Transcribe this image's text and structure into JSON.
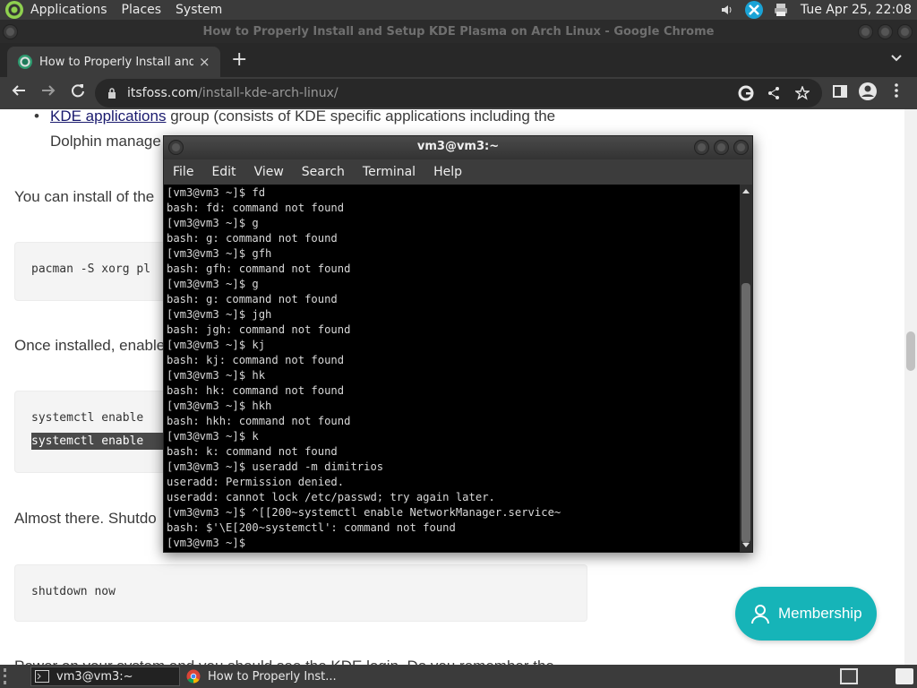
{
  "top_panel": {
    "menus": [
      "Applications",
      "Places",
      "System"
    ],
    "clock": "Tue Apr 25, 22:08",
    "tray_icons": [
      "volume-icon",
      "network-sync-icon",
      "printer-icon"
    ]
  },
  "chrome": {
    "window_title": "How to Properly Install and Setup KDE Plasma on Arch Linux - Google Chrome",
    "tab": {
      "title": "How to Properly Install and Setup KDE Plasma on Arch Linux",
      "close": "×"
    },
    "new_tab": "+",
    "url": {
      "host": "itsfoss.com",
      "path": "/install-kde-arch-linux/"
    }
  },
  "page": {
    "bullet_link": "KDE applications",
    "bullet_text_1": " group (consists of KDE specific applications including the",
    "bullet_text_2": "Dolphin manage",
    "bullet_text_2_tail": "...",
    "para_install": "You can install of the",
    "code_pacman": "pacman -S xorg pl",
    "para_once": "Once installed, enable",
    "code_systemctl_1": "systemctl enable",
    "code_systemctl_2": "systemctl enable",
    "para_almost": "Almost there. Shutdo",
    "code_shutdown": "shutdown now",
    "para_power": "Power on your system and you should see the KDE login. Do you remember the",
    "membership_button": "Membership"
  },
  "terminal": {
    "title": "vm3@vm3:~",
    "menu": [
      "File",
      "Edit",
      "View",
      "Search",
      "Terminal",
      "Help"
    ],
    "lines": [
      "[vm3@vm3 ~]$ fd",
      "bash: fd: command not found",
      "[vm3@vm3 ~]$ g",
      "bash: g: command not found",
      "[vm3@vm3 ~]$ gfh",
      "bash: gfh: command not found",
      "[vm3@vm3 ~]$ g",
      "bash: g: command not found",
      "[vm3@vm3 ~]$ jgh",
      "bash: jgh: command not found",
      "[vm3@vm3 ~]$ kj",
      "bash: kj: command not found",
      "[vm3@vm3 ~]$ hk",
      "bash: hk: command not found",
      "[vm3@vm3 ~]$ hkh",
      "bash: hkh: command not found",
      "[vm3@vm3 ~]$ k",
      "bash: k: command not found",
      "[vm3@vm3 ~]$ useradd -m dimitrios",
      "useradd: Permission denied.",
      "useradd: cannot lock /etc/passwd; try again later.",
      "[vm3@vm3 ~]$ ^[[200~systemctl enable NetworkManager.service~",
      "bash: $'\\E[200~systemctl': command not found",
      "[vm3@vm3 ~]$ "
    ]
  },
  "taskbar": {
    "items": [
      "vm3@vm3:~",
      "How to Properly Inst..."
    ]
  },
  "colors": {
    "membership": "#16b4b8",
    "link": "#1a1a6e",
    "highlight": "#4a4a4a"
  }
}
